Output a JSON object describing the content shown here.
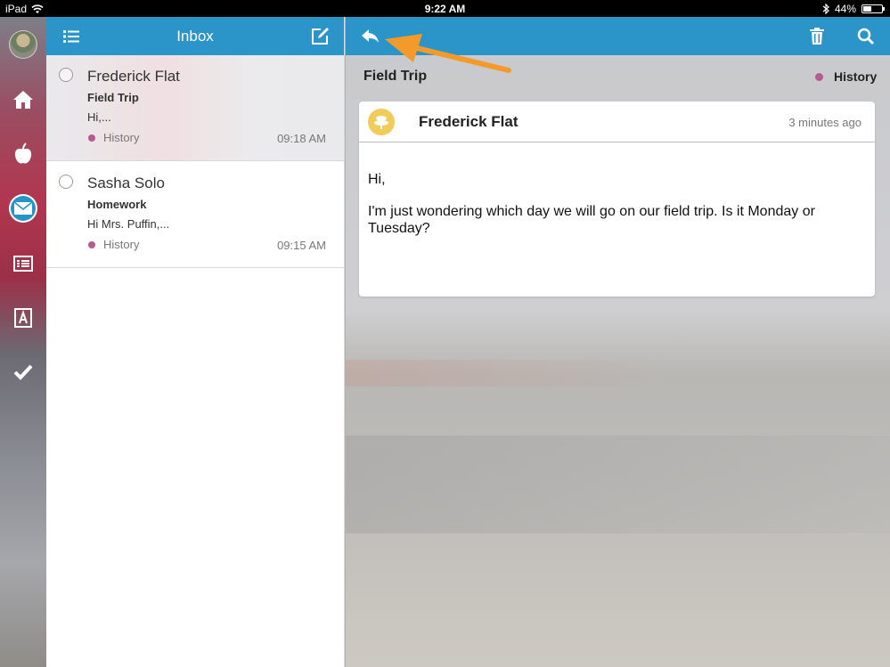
{
  "status_bar": {
    "device": "iPad",
    "time": "9:22 AM",
    "battery": "44%",
    "battery_level": 0.44
  },
  "rail": {
    "items": [
      "home-icon",
      "apple-icon",
      "mail-icon",
      "list-icon",
      "contacts-icon",
      "check-icon"
    ],
    "active": "mail-icon"
  },
  "inbox": {
    "title": "Inbox",
    "messages": [
      {
        "from": "Frederick Flat",
        "subject": "Field Trip",
        "preview": "Hi,...",
        "tag": "History",
        "time": "09:18 AM",
        "selected": true
      },
      {
        "from": "Sasha Solo",
        "subject": "Homework",
        "preview": "Hi Mrs. Puffin,...",
        "tag": "History",
        "time": "09:15 AM",
        "selected": false
      }
    ]
  },
  "reader": {
    "subject": "Field Trip",
    "tag": "History",
    "message": {
      "from": "Frederick Flat",
      "time": "3 minutes ago",
      "greeting": "Hi,",
      "body": "I'm just wondering which day we will go on our field trip. Is it Monday or Tuesday?"
    }
  },
  "colors": {
    "header_blue": "#2b95c9",
    "tag_dot": "#b85a92",
    "annotation_arrow": "#f49a2a",
    "avatar_yellow": "#f2cc5a"
  }
}
